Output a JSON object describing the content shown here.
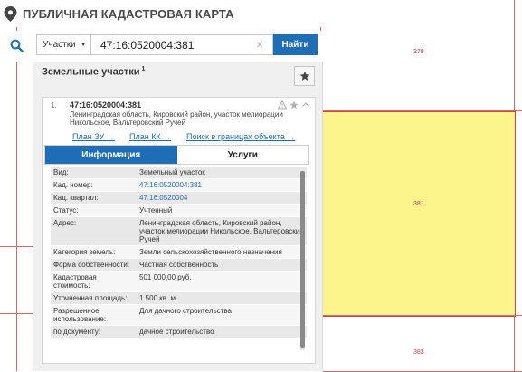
{
  "app": {
    "title": "ПУБЛИЧНАЯ КАДАСТРОВАЯ КАРТА"
  },
  "search": {
    "type_label": "Участки",
    "query": "47:16:0520004:381",
    "find_label": "Найти"
  },
  "panel": {
    "title": "Земельные участки",
    "count": "1"
  },
  "result": {
    "index": "1.",
    "cad_number": "47:16:0520004:381",
    "address": "Ленинградская область, Кировский район, участок мелиорации Никольское, Вальтеровский Ручей",
    "links": [
      "План ЗУ →",
      "План КК →",
      "Поиск в границах объекта →"
    ]
  },
  "tabs": [
    "Информация",
    "Услуги"
  ],
  "info_rows": [
    {
      "label": "Вид:",
      "value": "Земельный участок"
    },
    {
      "label": "Кад. номер:",
      "value": "47:16:0520004:381"
    },
    {
      "label": "Кад. квартал:",
      "value": "47:16:0520004"
    },
    {
      "label": "Статус:",
      "value": "Учтенный"
    },
    {
      "label": "Адрес:",
      "value": "Ленинградская область, Кировский район, участок мелиорации Никольское, Вальтеровский Ручей"
    },
    {
      "label": "Категория земель:",
      "value": "Земли сельскохозяйственного назначения"
    },
    {
      "label": "Форма собственности:",
      "value": "Частная собственность"
    },
    {
      "label": "Кадастровая стоимость:",
      "value": "501 000,00 руб."
    },
    {
      "label": "Уточненная площадь:",
      "value": "1 500 кв. м"
    },
    {
      "label": "Разрешенное использование:",
      "value": "Для дачного строительства"
    },
    {
      "label": "по документу:",
      "value": "дачное строительство"
    }
  ],
  "map": {
    "parcel_labels": [
      "379",
      "381",
      "383"
    ]
  },
  "colors": {
    "accent": "#1f6db5",
    "parcel_fill": "#fbf58c",
    "parcel_border": "#cc4444"
  }
}
